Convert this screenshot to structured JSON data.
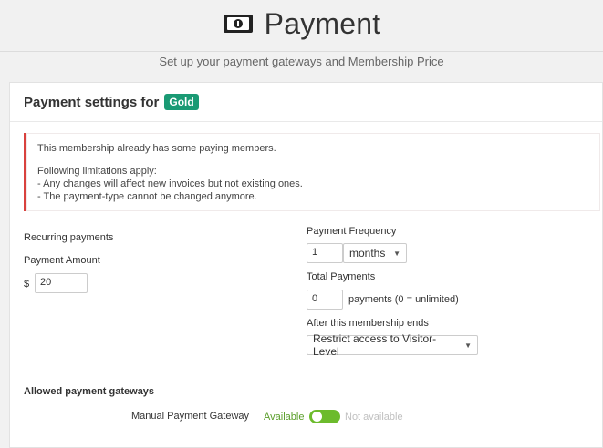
{
  "header": {
    "title": "Payment",
    "subtitle": "Set up your payment gateways and Membership Price",
    "icon": "money-bill-icon"
  },
  "card": {
    "heading": "Payment settings for",
    "membership_badge": "Gold",
    "badge_color": "#1a9a74",
    "notice": {
      "line1": "This membership already has some paying members.",
      "line2": "Following limitations apply:",
      "line3": "- Any changes will affect new invoices but not existing ones.",
      "line4": "- The payment-type cannot be changed anymore.",
      "border_color": "#d9413d"
    },
    "payment": {
      "type_label": "Recurring payments",
      "amount_label": "Payment Amount",
      "currency": "$",
      "amount_value": "20"
    },
    "frequency": {
      "label": "Payment Frequency",
      "value": "1",
      "unit": "months"
    },
    "total": {
      "label": "Total Payments",
      "value": "0",
      "suffix": "payments (0 = unlimited)"
    },
    "after_end": {
      "label": "After this membership ends",
      "value": "Restrict access to Visitor-Level"
    },
    "gateways": {
      "heading": "Allowed payment gateways",
      "items": [
        {
          "name": "Manual Payment Gateway",
          "on_label": "Available",
          "off_label": "Not available",
          "enabled": true
        }
      ]
    }
  }
}
